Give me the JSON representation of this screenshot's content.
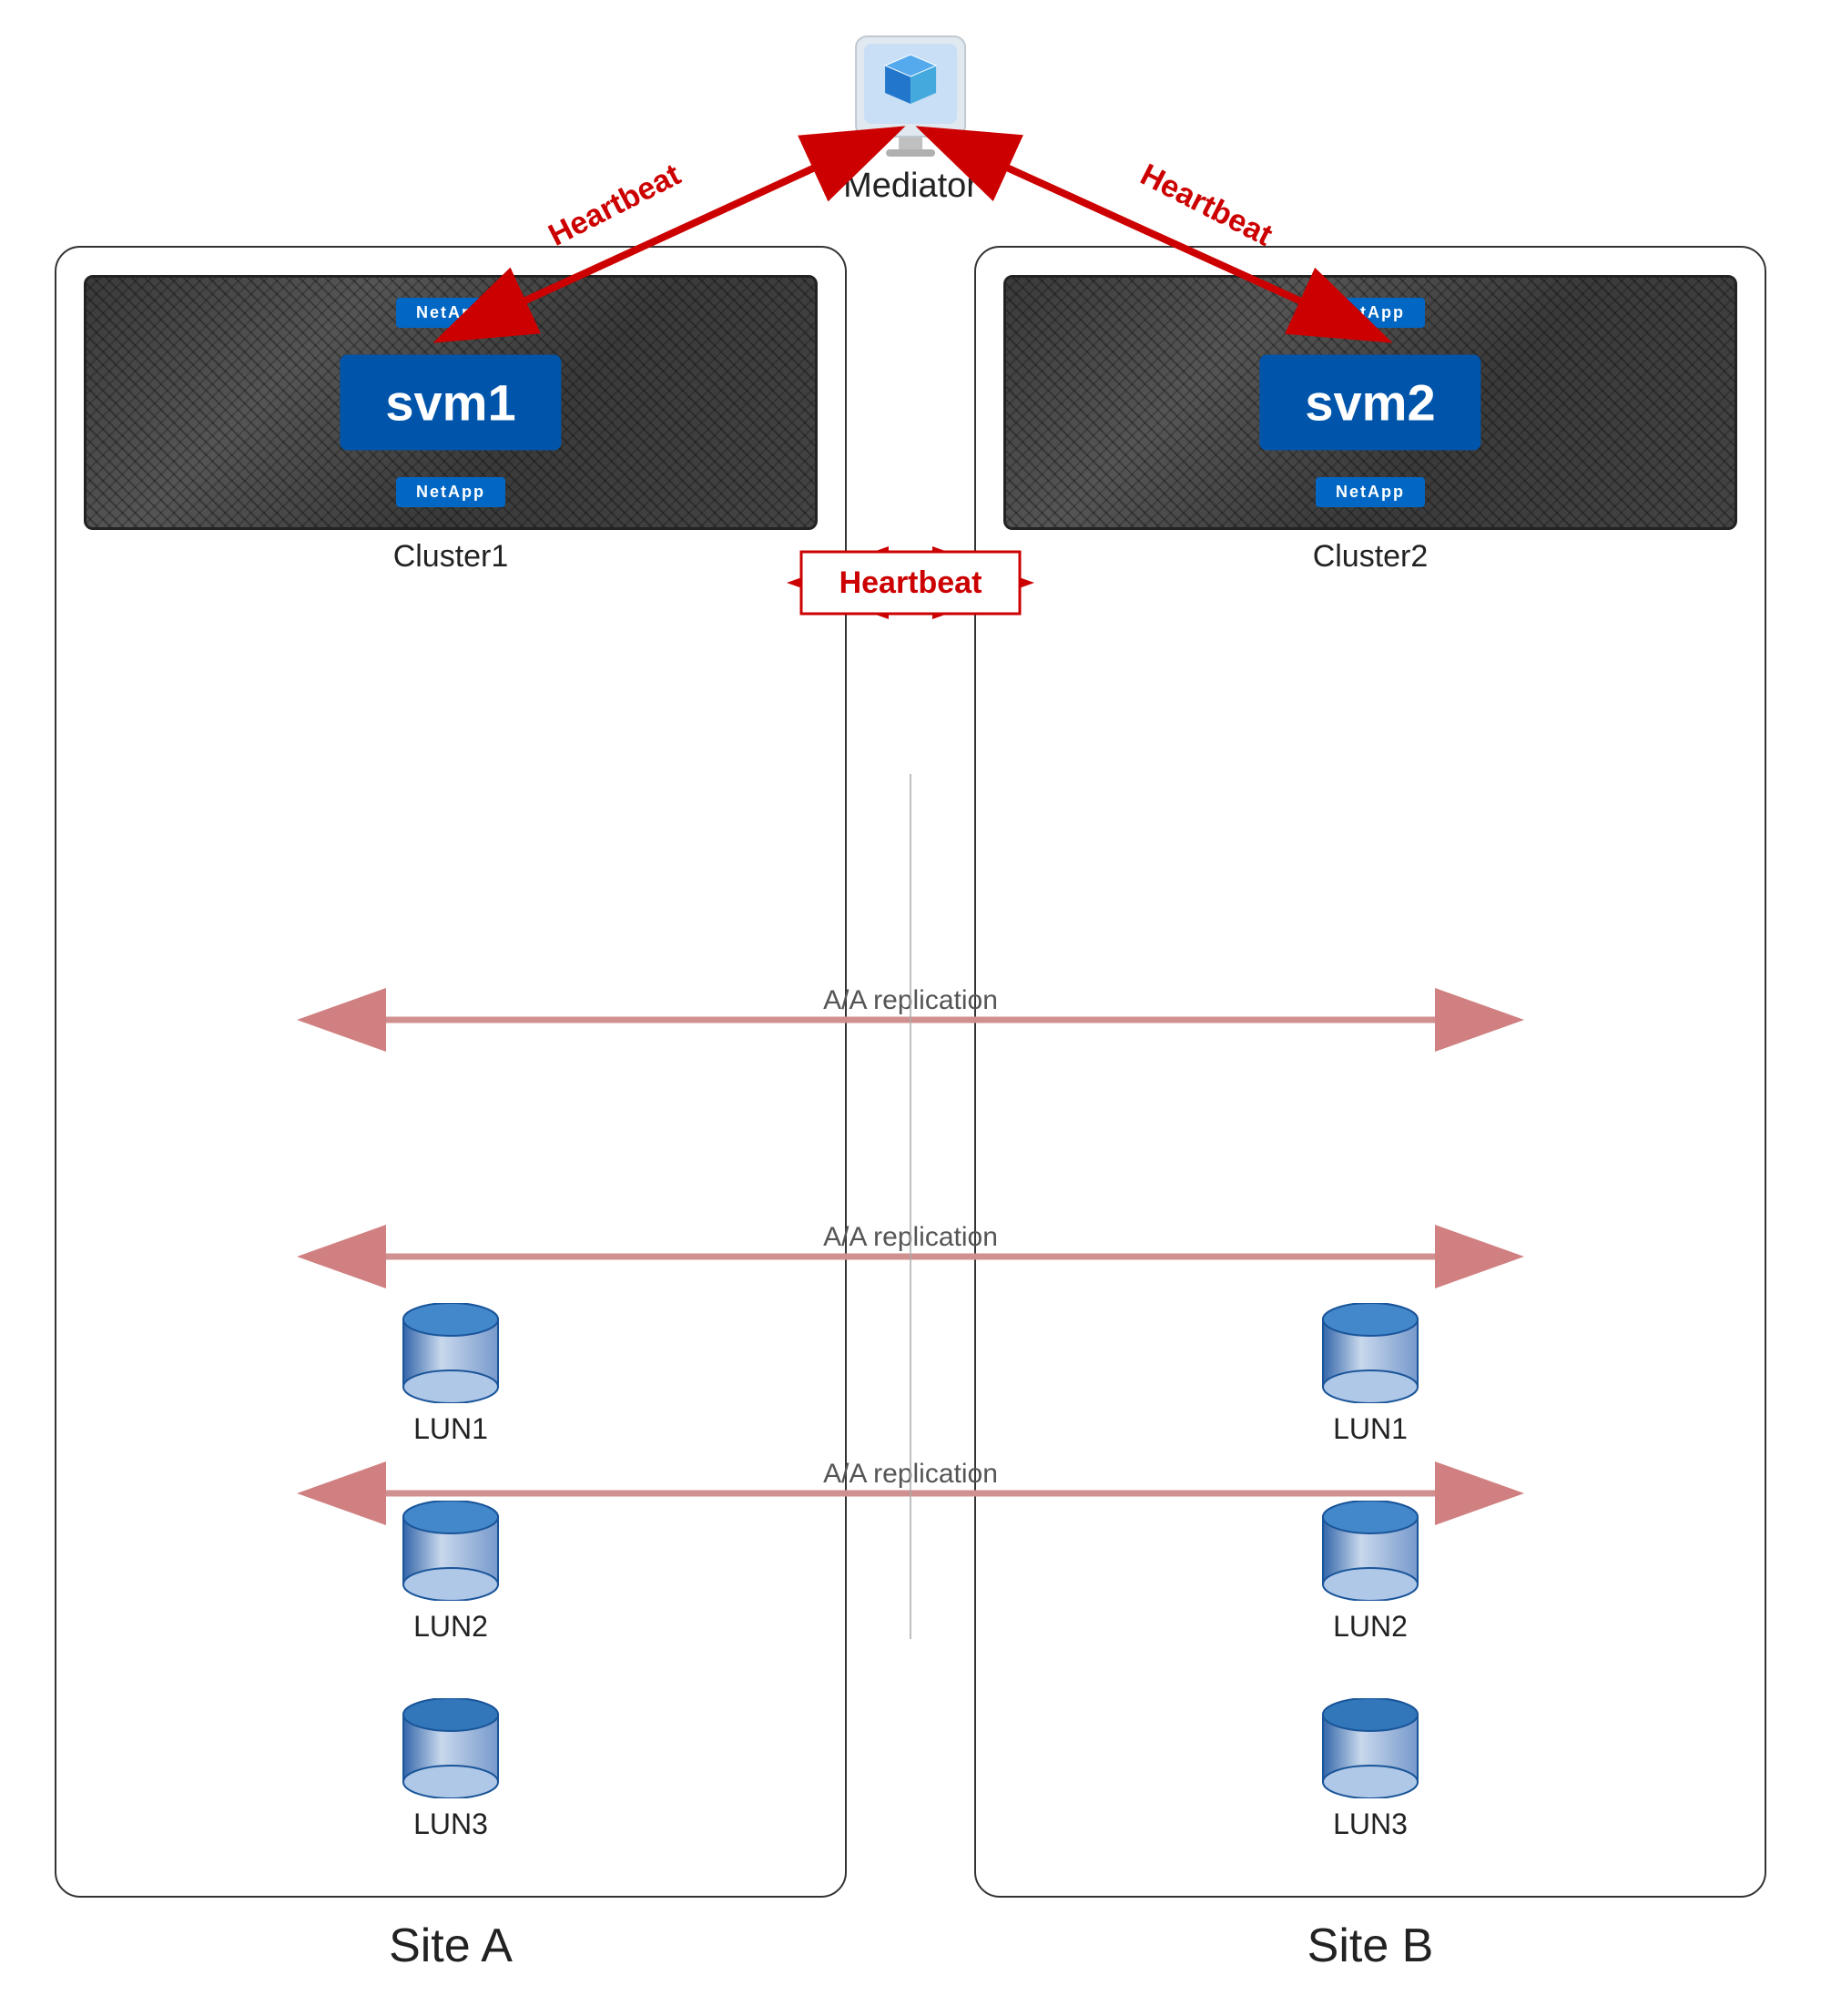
{
  "mediator": {
    "label": "Mediator",
    "icon": "mediator-icon"
  },
  "sites": [
    {
      "id": "site-a",
      "label": "Site A",
      "cluster": {
        "label": "Cluster1",
        "svm": "svm1",
        "brand": "NetApp"
      },
      "luns": [
        {
          "label": "LUN1"
        },
        {
          "label": "LUN2"
        },
        {
          "label": "LUN3"
        }
      ]
    },
    {
      "id": "site-b",
      "label": "Site B",
      "cluster": {
        "label": "Cluster2",
        "svm": "svm2",
        "brand": "NetApp"
      },
      "luns": [
        {
          "label": "LUN1"
        },
        {
          "label": "LUN2"
        },
        {
          "label": "LUN3"
        }
      ]
    }
  ],
  "arrows": {
    "heartbeat_label": "Heartbeat",
    "aa_replication_label": "A/A replication"
  },
  "colors": {
    "red_arrow": "#CC0000",
    "pink_arrow": "#E8A0A0",
    "site_border": "#333333",
    "svm_blue": "#0055AA",
    "netapp_blue": "#0067C5",
    "server_dark": "#3a3a3a"
  }
}
